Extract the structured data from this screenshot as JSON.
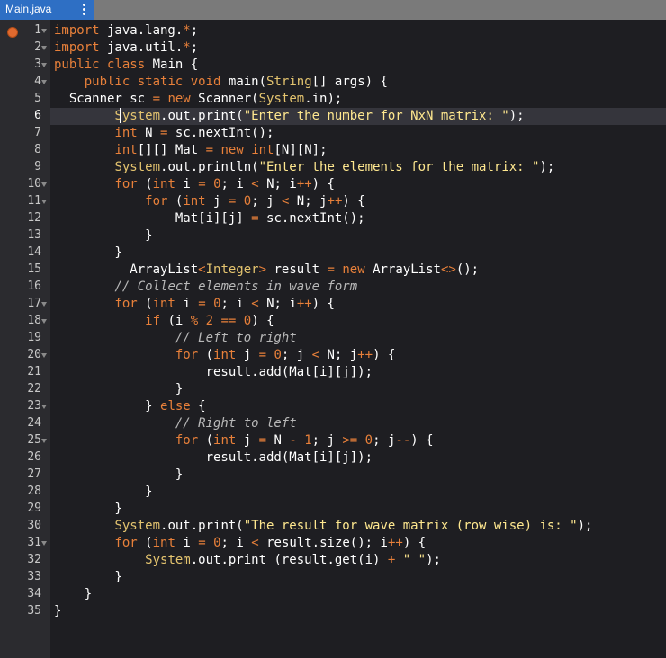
{
  "tab": {
    "filename": "Main.java"
  },
  "colors": {
    "accent": "#2e6fc4",
    "error_marker": "#e06a2f",
    "keyword": "#e8803a",
    "string": "#ffe88f",
    "comment": "#b8b8b8"
  },
  "icons": {
    "tab_menu": "vertical-ellipsis-icon",
    "error": "error-dot-icon",
    "fold": "fold-arrow-icon"
  },
  "editor": {
    "active_line": 6,
    "line_numbers": [
      "1",
      "2",
      "3",
      "4",
      "5",
      "6",
      "7",
      "8",
      "9",
      "10",
      "11",
      "12",
      "13",
      "14",
      "15",
      "16",
      "17",
      "18",
      "19",
      "20",
      "21",
      "22",
      "23",
      "24",
      "25",
      "26",
      "27",
      "28",
      "29",
      "30",
      "31",
      "32",
      "33",
      "34",
      "35"
    ],
    "lines": [
      "import java.lang.*;",
      "import java.util.*;",
      "public class Main {",
      "    public static void main(String[] args) {",
      "  Scanner sc = new Scanner(System.in);",
      "        System.out.print(\"Enter the number for NxN matrix: \");",
      "        int N = sc.nextInt();",
      "        int[][] Mat = new int[N][N];",
      "        System.out.println(\"Enter the elements for the matrix: \");",
      "        for (int i = 0; i < N; i++) {",
      "            for (int j = 0; j < N; j++) {",
      "                Mat[i][j] = sc.nextInt();",
      "            }",
      "        }",
      "          ArrayList<Integer> result = new ArrayList<>();",
      "        // Collect elements in wave form",
      "        for (int i = 0; i < N; i++) {",
      "            if (i % 2 == 0) {",
      "                // Left to right",
      "                for (int j = 0; j < N; j++) {",
      "                    result.add(Mat[i][j]);",
      "                }",
      "            } else {",
      "                // Right to left",
      "                for (int j = N - 1; j >= 0; j--) {",
      "                    result.add(Mat[i][j]);",
      "                }",
      "            }",
      "        }",
      "        System.out.print(\"The result for wave matrix (row wise) is: \");",
      "        for (int i = 0; i < result.size(); i++) {",
      "            System.out.print (result.get(i) + \" \");",
      "        }",
      "    }",
      "}"
    ]
  }
}
